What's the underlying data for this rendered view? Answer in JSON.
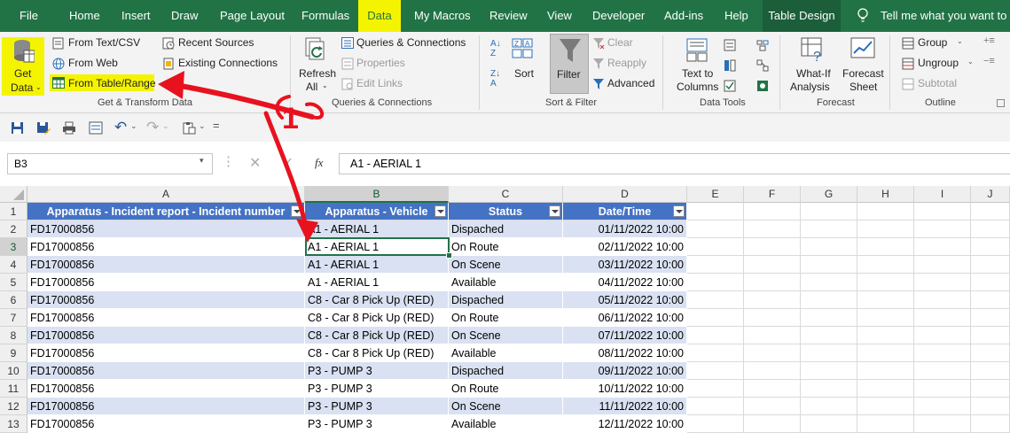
{
  "menu": {
    "tabs": [
      "File",
      "Home",
      "Insert",
      "Draw",
      "Page Layout",
      "Formulas",
      "Data",
      "My Macros",
      "Review",
      "View",
      "Developer",
      "Add-ins",
      "Help",
      "Table Design"
    ],
    "tell_me": "Tell me what you want to do"
  },
  "ribbon": {
    "get_transform": {
      "get_data_line1": "Get",
      "get_data_line2": "Data",
      "from_text_csv": "From Text/CSV",
      "from_web": "From Web",
      "from_table_range": "From Table/Range",
      "recent_sources": "Recent Sources",
      "existing_connections": "Existing Connections",
      "label": "Get & Transform Data"
    },
    "queries": {
      "refresh_line1": "Refresh",
      "refresh_line2": "All",
      "queries_connections": "Queries & Connections",
      "properties": "Properties",
      "edit_links": "Edit Links",
      "label": "Queries & Connections"
    },
    "sort_filter": {
      "sort": "Sort",
      "filter": "Filter",
      "clear": "Clear",
      "reapply": "Reapply",
      "advanced": "Advanced",
      "label": "Sort & Filter"
    },
    "data_tools": {
      "text_to_line1": "Text to",
      "text_to_line2": "Columns",
      "label": "Data Tools"
    },
    "forecast": {
      "whatif_line1": "What-If",
      "whatif_line2": "Analysis",
      "forecast_line1": "Forecast",
      "forecast_line2": "Sheet",
      "label": "Forecast"
    },
    "outline": {
      "group": "Group",
      "ungroup": "Ungroup",
      "subtotal": "Subtotal",
      "label": "Outline"
    }
  },
  "annotation": {
    "number": "1",
    "color": "#e8121f"
  },
  "formula_bar": {
    "name_box": "B3",
    "fx": "fx",
    "formula": "A1 - AERIAL 1"
  },
  "grid": {
    "columns": [
      "A",
      "B",
      "C",
      "D",
      "E",
      "F",
      "G",
      "H",
      "I",
      "J"
    ],
    "header": [
      "Apparatus - Incident report - Incident number",
      "Apparatus - Vehicle",
      "Status",
      "Date/Time"
    ],
    "rows": [
      [
        "FD17000856",
        "A1 - AERIAL 1",
        "Dispached",
        "01/11/2022 10:00"
      ],
      [
        "FD17000856",
        "A1 - AERIAL 1",
        "On Route",
        "02/11/2022 10:00"
      ],
      [
        "FD17000856",
        "A1 - AERIAL 1",
        "On Scene",
        "03/11/2022 10:00"
      ],
      [
        "FD17000856",
        "A1 - AERIAL 1",
        "Available",
        "04/11/2022 10:00"
      ],
      [
        "FD17000856",
        "C8 - Car 8 Pick Up (RED)",
        "Dispached",
        "05/11/2022 10:00"
      ],
      [
        "FD17000856",
        "C8 - Car 8 Pick Up (RED)",
        "On Route",
        "06/11/2022 10:00"
      ],
      [
        "FD17000856",
        "C8 - Car 8 Pick Up (RED)",
        "On Scene",
        "07/11/2022 10:00"
      ],
      [
        "FD17000856",
        "C8 - Car 8 Pick Up (RED)",
        "Available",
        "08/11/2022 10:00"
      ],
      [
        "FD17000856",
        "P3 - PUMP 3",
        "Dispached",
        "09/11/2022 10:00"
      ],
      [
        "FD17000856",
        "P3 - PUMP 3",
        "On Route",
        "10/11/2022 10:00"
      ],
      [
        "FD17000856",
        "P3 - PUMP 3",
        "On Scene",
        "11/11/2022 10:00"
      ],
      [
        "FD17000856",
        "P3 - PUMP 3",
        "Available",
        "12/11/2022 10:00"
      ]
    ],
    "row_numbers": [
      "1",
      "2",
      "3",
      "4",
      "5",
      "6",
      "7",
      "8",
      "9",
      "10",
      "11",
      "12",
      "13"
    ]
  }
}
